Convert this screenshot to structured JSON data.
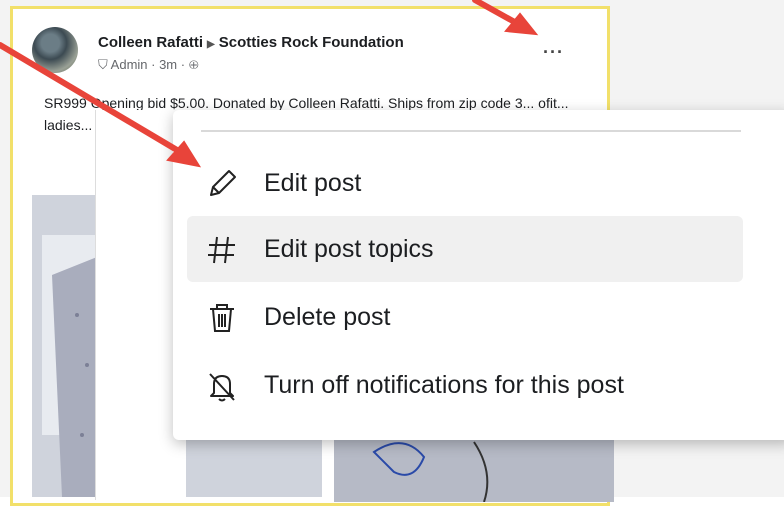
{
  "post": {
    "author": "Colleen Rafatti",
    "group": "Scotties Rock Foundation",
    "meta": "Admin · 3m ·",
    "text": "SR999  Opening bid $5.00.  Donated by Colleen Rafatti.  Ships from zip code 3... ofit... ladies... shades..."
  },
  "menu": {
    "items": [
      {
        "label": "Edit post",
        "icon": "pencil-icon"
      },
      {
        "label": "Edit post topics",
        "icon": "hashtag-icon"
      },
      {
        "label": "Delete post",
        "icon": "trash-icon"
      },
      {
        "label": "Turn off notifications for this post",
        "icon": "bell-off-icon"
      }
    ]
  },
  "colors": {
    "highlight_border": "#f2e06a",
    "arrow": "#e8443a"
  }
}
